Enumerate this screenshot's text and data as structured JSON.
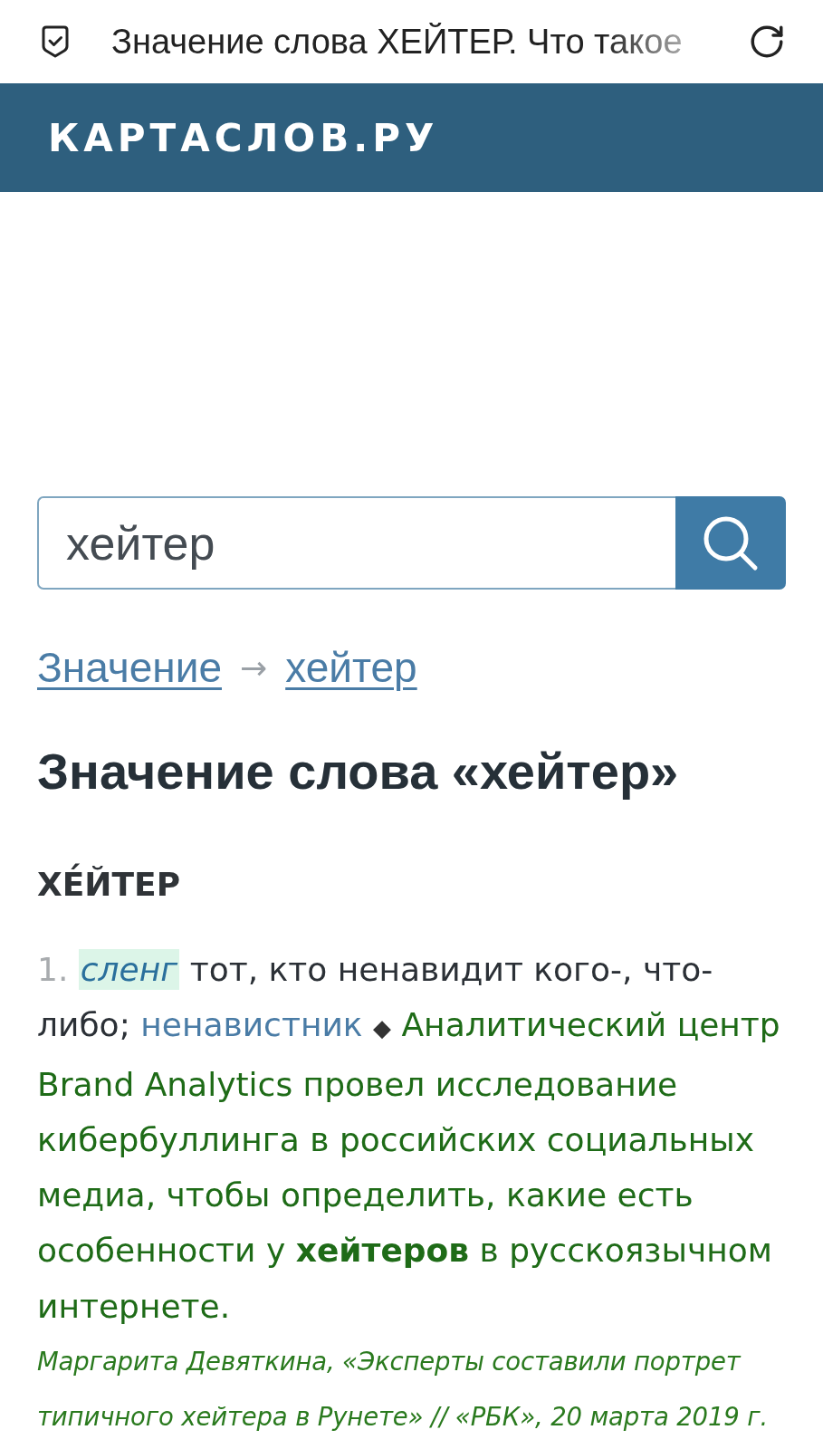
{
  "browser_bar": {
    "title": "Значение слова ХЕЙТЕР. Что такое"
  },
  "site_header": {
    "logo": "КАРТАСЛОВ.РУ"
  },
  "search": {
    "value": "хейтер"
  },
  "breadcrumbs": {
    "items": [
      {
        "label": "Значение"
      },
      {
        "label": "хейтер"
      }
    ],
    "separator": "→"
  },
  "heading": "Значение слова «хейтер»",
  "entry": {
    "headword": "ХЕ́ЙТЕР",
    "senses": [
      {
        "number": "1.",
        "label": "сленг",
        "definition": "тот, кто ненавидит кого-, что-либо;",
        "synonym": "ненавистник",
        "example_marker": "◆",
        "example": "Аналитический центр Brand Analytics провел исследование кибербуллинга в российских социальных медиа, чтобы определить, какие есть особенности у **хейтеров** в русскоязычном интернете.",
        "citation": "Маргарита Девяткина, «Эксперты составили портрет типичного хейтера в Рунете» // «РБК», 20 марта 2019 г."
      }
    ]
  }
}
